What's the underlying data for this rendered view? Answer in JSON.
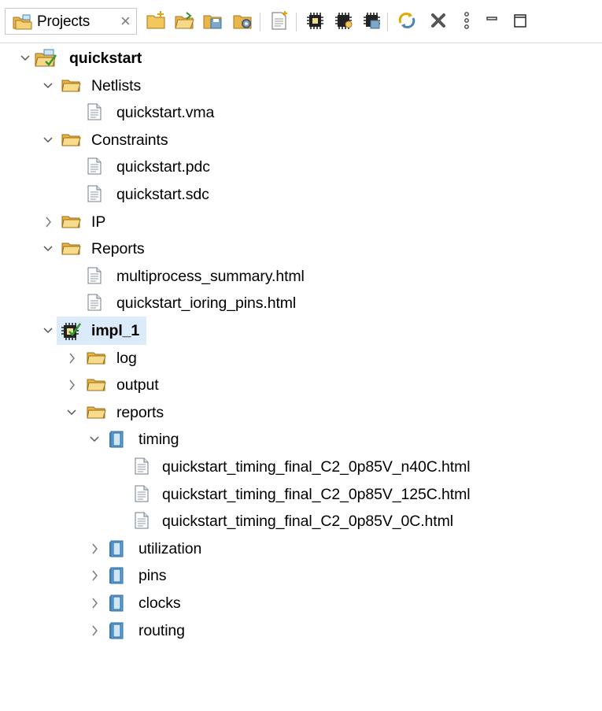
{
  "tab": {
    "label": "Projects",
    "close": "×"
  },
  "toolbar": {
    "buttons": [
      {
        "name": "new-project-icon"
      },
      {
        "name": "open-project-icon"
      },
      {
        "name": "save-project-icon"
      },
      {
        "name": "project-settings-icon"
      },
      {
        "name": "new-file-icon"
      },
      {
        "name": "run-synthesis-icon"
      },
      {
        "name": "run-implementation-icon"
      },
      {
        "name": "save-implementation-icon"
      },
      {
        "name": "refresh-icon"
      },
      {
        "name": "delete-icon"
      },
      {
        "name": "view-menu-icon"
      },
      {
        "name": "minimize-icon"
      },
      {
        "name": "maximize-icon"
      }
    ]
  },
  "tree": [
    {
      "label": "quickstart",
      "level": 0,
      "chevron": "down",
      "icon": "project",
      "bold": true
    },
    {
      "label": "Netlists",
      "level": 1,
      "chevron": "down",
      "icon": "folder"
    },
    {
      "label": "quickstart.vma",
      "level": 2,
      "chevron": "none",
      "icon": "file"
    },
    {
      "label": "Constraints",
      "level": 1,
      "chevron": "down",
      "icon": "folder"
    },
    {
      "label": "quickstart.pdc",
      "level": 2,
      "chevron": "none",
      "icon": "file"
    },
    {
      "label": "quickstart.sdc",
      "level": 2,
      "chevron": "none",
      "icon": "file"
    },
    {
      "label": "IP",
      "level": 1,
      "chevron": "right",
      "icon": "folder"
    },
    {
      "label": "Reports",
      "level": 1,
      "chevron": "down",
      "icon": "folder"
    },
    {
      "label": "multiprocess_summary.html",
      "level": 2,
      "chevron": "none",
      "icon": "file"
    },
    {
      "label": "quickstart_ioring_pins.html",
      "level": 2,
      "chevron": "none",
      "icon": "file"
    },
    {
      "label": "impl_1",
      "level": 1,
      "chevron": "down",
      "icon": "chip",
      "bold": true,
      "selected": true
    },
    {
      "label": "log",
      "level": 2,
      "chevron": "right",
      "icon": "folder"
    },
    {
      "label": "output",
      "level": 2,
      "chevron": "right",
      "icon": "folder"
    },
    {
      "label": "reports",
      "level": 2,
      "chevron": "down",
      "icon": "folder"
    },
    {
      "label": "timing",
      "level": 3,
      "chevron": "down",
      "icon": "book"
    },
    {
      "label": "quickstart_timing_final_C2_0p85V_n40C.html",
      "level": 4,
      "chevron": "none",
      "icon": "file"
    },
    {
      "label": "quickstart_timing_final_C2_0p85V_125C.html",
      "level": 4,
      "chevron": "none",
      "icon": "file"
    },
    {
      "label": "quickstart_timing_final_C2_0p85V_0C.html",
      "level": 4,
      "chevron": "none",
      "icon": "file"
    },
    {
      "label": "utilization",
      "level": 3,
      "chevron": "right",
      "icon": "book"
    },
    {
      "label": "pins",
      "level": 3,
      "chevron": "right",
      "icon": "book"
    },
    {
      "label": "clocks",
      "level": 3,
      "chevron": "right",
      "icon": "book"
    },
    {
      "label": "routing",
      "level": 3,
      "chevron": "right",
      "icon": "book"
    }
  ]
}
